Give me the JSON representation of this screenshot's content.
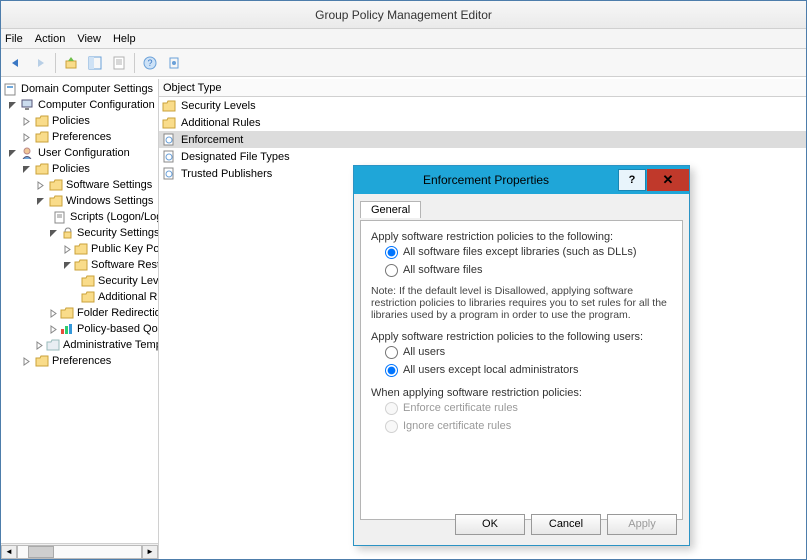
{
  "window": {
    "title": "Group Policy Management Editor"
  },
  "menu": {
    "file": "File",
    "action": "Action",
    "view": "View",
    "help": "Help"
  },
  "tree": {
    "root": "Domain Computer Settings",
    "cc": "Computer Configuration",
    "cc_policies": "Policies",
    "cc_prefs": "Preferences",
    "uc": "User Configuration",
    "uc_policies": "Policies",
    "sw_settings": "Software Settings",
    "win_settings": "Windows Settings",
    "scripts": "Scripts (Logon/Logoff)",
    "sec_settings": "Security Settings",
    "public_key": "Public Key Policies",
    "srp": "Software Restriction Policies",
    "srp_sec": "Security Levels",
    "srp_add": "Additional Rules",
    "folder_redir": "Folder Redirection",
    "policy_based": "Policy-based QoS",
    "admin_tmpl": "Administrative Templates",
    "uc_prefs": "Preferences"
  },
  "list": {
    "header": "Object Type",
    "items": [
      "Security Levels",
      "Additional Rules",
      "Enforcement",
      "Designated File Types",
      "Trusted Publishers"
    ],
    "selected_index": 2
  },
  "dialog": {
    "title": "Enforcement Properties",
    "tab": "General",
    "sec1_label": "Apply software restriction policies to the following:",
    "opt1a": "All software files except libraries (such as DLLs)",
    "opt1b": "All software files",
    "note": "Note:  If the default level is Disallowed, applying software restriction policies to libraries requires you to set rules for all the libraries used by a program in order to use the program.",
    "sec2_label": "Apply software restriction policies to the following users:",
    "opt2a": "All users",
    "opt2b": "All users except local administrators",
    "sec3_label": "When applying software restriction policies:",
    "opt3a": "Enforce certificate rules",
    "opt3b": "Ignore certificate rules",
    "ok": "OK",
    "cancel": "Cancel",
    "apply": "Apply"
  }
}
